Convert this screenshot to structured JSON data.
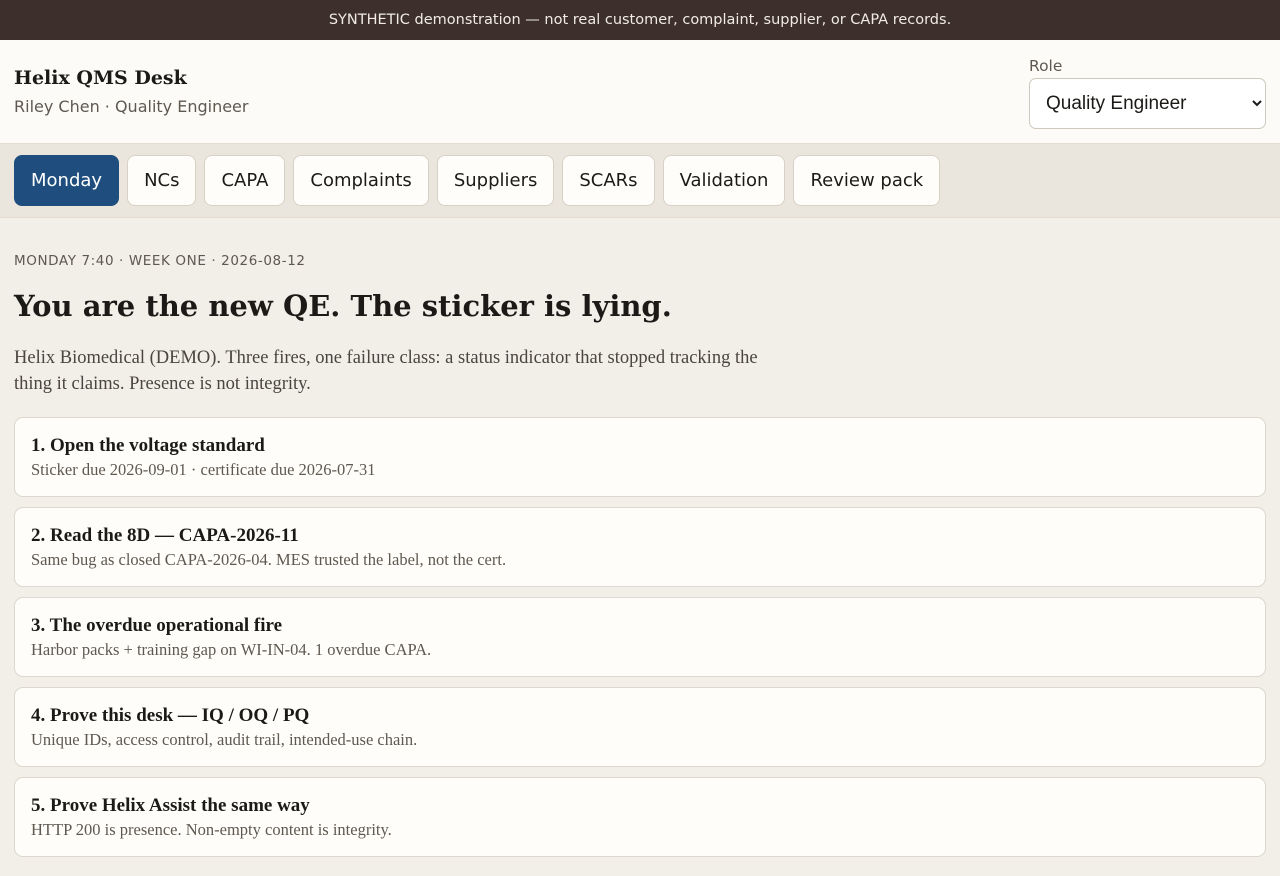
{
  "banner": {
    "text": "SYNTHETIC demonstration — not real customer, complaint, supplier, or CAPA records."
  },
  "header": {
    "app_title": "Helix QMS Desk",
    "user_line": "Riley Chen · Quality Engineer",
    "role_label": "Role",
    "role_selected": "Quality Engineer"
  },
  "tabs": [
    {
      "label": "Monday",
      "active": true
    },
    {
      "label": "NCs",
      "active": false
    },
    {
      "label": "CAPA",
      "active": false
    },
    {
      "label": "Complaints",
      "active": false
    },
    {
      "label": "Suppliers",
      "active": false
    },
    {
      "label": "SCARs",
      "active": false
    },
    {
      "label": "Validation",
      "active": false
    },
    {
      "label": "Review pack",
      "active": false
    }
  ],
  "main": {
    "eyebrow": "MONDAY 7:40 · WEEK ONE · 2026-08-12",
    "headline": "You are the new QE. The sticker is lying.",
    "lead": "Helix Biomedical (DEMO). Three fires, one failure class: a status indicator that stopped tracking the thing it claims. Presence is not integrity.",
    "cards": [
      {
        "title": "1. Open the voltage standard",
        "sub": "Sticker due 2026-09-01 · certificate due 2026-07-31"
      },
      {
        "title": "2. Read the 8D — CAPA-2026-11",
        "sub": "Same bug as closed CAPA-2026-04. MES trusted the label, not the cert."
      },
      {
        "title": "3. The overdue operational fire",
        "sub": "Harbor packs + training gap on WI-IN-04. 1 overdue CAPA."
      },
      {
        "title": "4. Prove this desk — IQ / OQ / PQ",
        "sub": "Unique IDs, access control, audit trail, intended-use chain."
      },
      {
        "title": "5. Prove Helix Assist the same way",
        "sub": "HTTP 200 is presence. Non-empty content is integrity."
      }
    ]
  },
  "colors": {
    "banner_bg": "#3d2f2b",
    "accent": "#1f4e7e",
    "page_bg": "#f2efe9"
  }
}
